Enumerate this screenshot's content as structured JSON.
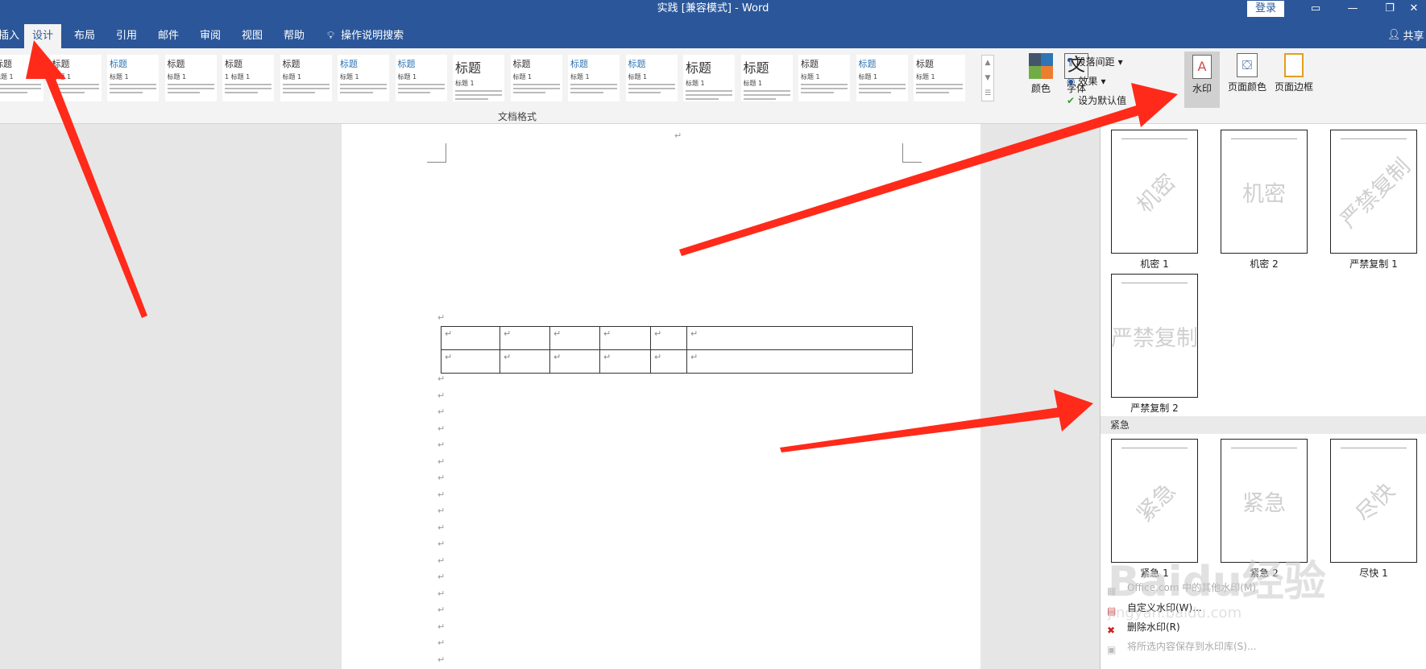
{
  "window": {
    "title": "实践 [兼容模式] - Word",
    "login": "登录",
    "share": "共享"
  },
  "tabs": [
    {
      "label": "插入"
    },
    {
      "label": "设计"
    },
    {
      "label": "布局"
    },
    {
      "label": "引用"
    },
    {
      "label": "邮件"
    },
    {
      "label": "审阅"
    },
    {
      "label": "视图"
    },
    {
      "label": "帮助"
    },
    {
      "label": "操作说明搜索"
    }
  ],
  "ribbon": {
    "group_label": "文档格式",
    "colors": "颜色",
    "fonts": "字体",
    "paragraph_spacing": "段落间距",
    "effects": "效果",
    "set_default": "设为默认值",
    "watermark": "水印",
    "page_color": "页面颜色",
    "page_borders": "页面边框",
    "style_thumbs": [
      "标题",
      "标题",
      "标题",
      "标题",
      "标题",
      "标题",
      "标题",
      "标题",
      "标题",
      "标题",
      "标题",
      "标题",
      "标题",
      "标题",
      "标题",
      "标题",
      "标题"
    ],
    "style_subtitles": [
      "标题 1",
      "标题 1",
      "标题 1",
      "标题 1",
      "1 标题 1",
      "标题 1",
      "标题 1",
      "标题 1",
      "标题 1",
      "标题 1",
      "标题 1",
      "标题 1",
      "标题 1",
      "标题 1",
      "标题 1",
      "标题 1"
    ]
  },
  "watermark_panel": {
    "items": [
      {
        "caption": "机密 1",
        "text": "机密",
        "diagonal": true
      },
      {
        "caption": "机密 2",
        "text": "机密",
        "diagonal": false
      },
      {
        "caption": "严禁复制 1",
        "text": "严禁复制",
        "diagonal": true
      },
      {
        "caption": "严禁复制 2",
        "text": "严禁复制",
        "diagonal": false
      }
    ],
    "section_urgent": "紧急",
    "urgent_items": [
      {
        "caption": "紧急 1",
        "text": "紧急",
        "diagonal": true
      },
      {
        "caption": "紧急 2",
        "text": "紧急",
        "diagonal": false
      },
      {
        "caption": "尽快 1",
        "text": "尽快",
        "diagonal": true
      }
    ],
    "menu": [
      {
        "label": "Office.com 中的其他水印(M)",
        "disabled": true
      },
      {
        "label": "自定义水印(W)...",
        "disabled": false
      },
      {
        "label": "删除水印(R)",
        "disabled": false
      },
      {
        "label": "将所选内容保存到水印库(S)...",
        "disabled": true
      }
    ]
  },
  "overlay": {
    "brand": "Baidu经验",
    "url": "jingyan.baidu.com"
  },
  "colors": {
    "accent": "#2b579a",
    "arrow": "#ff2a1a"
  }
}
